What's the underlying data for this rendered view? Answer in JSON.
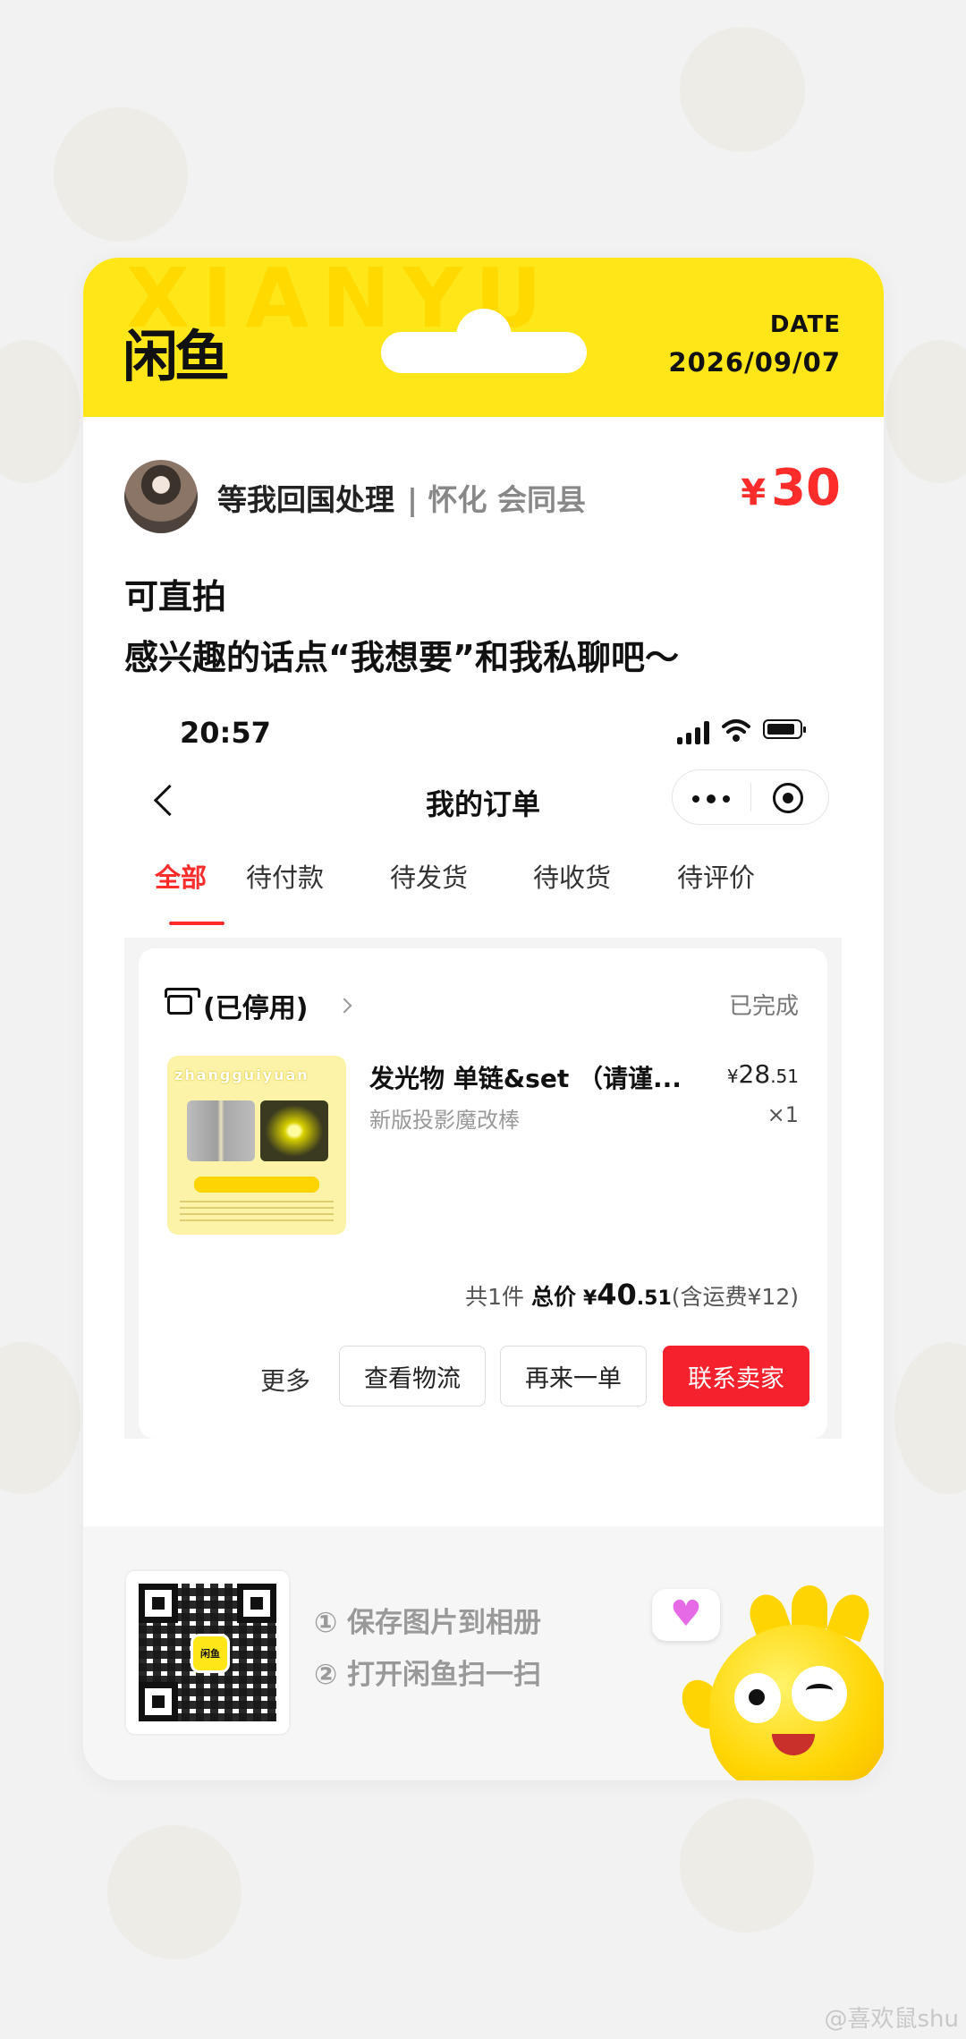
{
  "header": {
    "watermark": "XIANYU",
    "logo": "闲鱼",
    "date_label": "DATE",
    "date_value": "2026/09/07"
  },
  "listing": {
    "seller_name": "等我回国处理",
    "seller_location": "| 怀化 会同县",
    "price_currency": "¥",
    "price_value": "30",
    "description_line1": "可直拍",
    "description_line2": "感兴趣的话点“我想要”和我私聊吧～"
  },
  "screenshot": {
    "status_time": "20:57",
    "nav_title": "我的订单",
    "tabs": [
      "全部",
      "待付款",
      "待发货",
      "待收货",
      "待评价"
    ],
    "active_tab": "全部",
    "order": {
      "shop_name": "(已停用)",
      "status": "已完成",
      "thumbnail_text": "zhangguiyuan",
      "item_title": "发光物 单链&set （请谨...",
      "item_subtitle": "新版投影魔改棒",
      "item_price_currency": "¥",
      "item_price_int": "28",
      "item_price_dec": ".51",
      "item_qty": "×1",
      "summary_count": "共1件",
      "summary_total_label": "总价",
      "summary_total_currency": "¥",
      "summary_total_int": "40",
      "summary_total_dec": ".51",
      "summary_shipping": "(含运费¥12)",
      "more_label": "更多",
      "buttons": {
        "logistics": "查看物流",
        "reorder": "再来一单",
        "contact": "联系卖家"
      }
    }
  },
  "footer": {
    "qr_logo": "闲鱼",
    "step1": "① 保存图片到相册",
    "step2": "② 打开闲鱼扫一扫"
  },
  "credit": "@喜欢鼠shu",
  "colors": {
    "brand_yellow": "#ffe619",
    "price_red": "#ff2c2c",
    "contact_button": "#f5222d"
  },
  "icons": [
    "back-icon",
    "more-dots-icon",
    "target-icon",
    "shop-icon",
    "chevron-right-icon",
    "heart-icon",
    "signal-icon",
    "wifi-icon",
    "battery-icon"
  ]
}
